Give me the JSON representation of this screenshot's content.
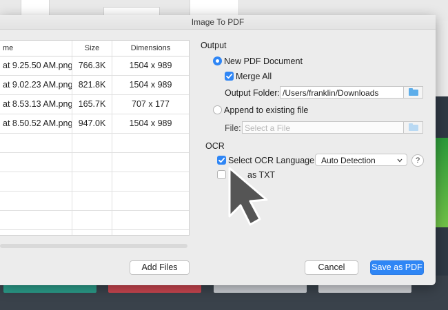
{
  "window": {
    "title": "Image To PDF"
  },
  "table": {
    "columns": [
      "me",
      "Size",
      "Dimensions"
    ],
    "rows": [
      {
        "name": "at 9.25.50 AM.png",
        "size": "766.3K",
        "dimensions": "1504 x 989"
      },
      {
        "name": "at 9.02.23 AM.png",
        "size": "821.8K",
        "dimensions": "1504 x 989"
      },
      {
        "name": "at 8.53.13 AM.png",
        "size": "165.7K",
        "dimensions": "707 x 177"
      },
      {
        "name": "at 8.50.52 AM.png",
        "size": "947.0K",
        "dimensions": "1504 x 989"
      }
    ]
  },
  "output": {
    "section_title": "Output",
    "new_pdf_label": "New PDF Document",
    "new_pdf_selected": true,
    "merge_all_label": "Merge All",
    "merge_all_checked": true,
    "output_folder_label": "Output Folder:",
    "output_folder_value": "/Users/franklin/Downloads",
    "append_label": "Append to existing file",
    "append_selected": false,
    "file_label": "File:",
    "file_placeholder": "Select a File"
  },
  "ocr": {
    "section_title": "OCR",
    "select_language_label": "Select OCR Language:",
    "select_language_checked": true,
    "language_value": "Auto Detection",
    "help_label": "?",
    "save_txt_label": "as TXT",
    "save_txt_checked": false
  },
  "buttons": {
    "add_files": "Add Files",
    "cancel": "Cancel",
    "save_as_pdf": "Save as PDF"
  },
  "colors": {
    "accent": "#2f86f5",
    "folder": "#5eaeea",
    "cursor": "#555555"
  },
  "icons": {
    "folder": "folder-icon",
    "chevron": "chevron-down-icon",
    "checkmark": "checkmark-icon",
    "cursor": "mouse-pointer-icon"
  }
}
